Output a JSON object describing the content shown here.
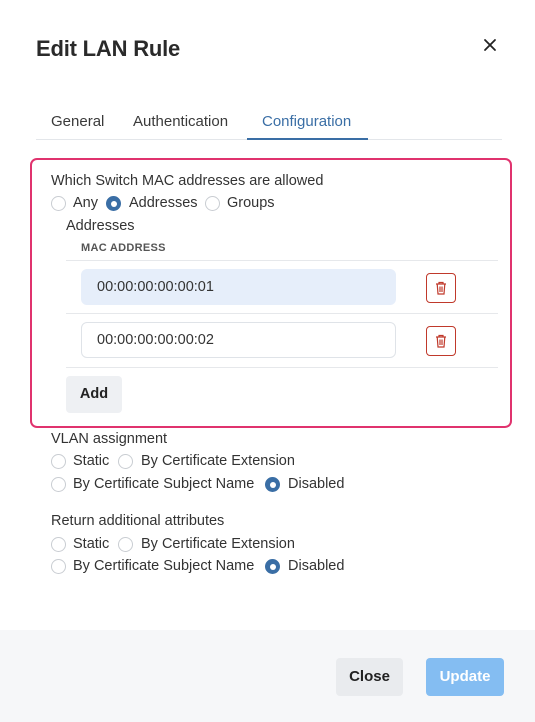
{
  "dialog": {
    "title": "Edit LAN Rule"
  },
  "tabs": [
    {
      "label": "General",
      "active": false
    },
    {
      "label": "Authentication",
      "active": false
    },
    {
      "label": "Configuration",
      "active": true
    }
  ],
  "switch_mac": {
    "question": "Which Switch MAC addresses are allowed",
    "options": [
      "Any",
      "Addresses",
      "Groups"
    ],
    "selected": "Addresses",
    "addresses_label": "Addresses",
    "column_header": "MAC ADDRESS",
    "entries": [
      "00:00:00:00:00:01",
      "00:00:00:00:00:02"
    ],
    "add_label": "Add"
  },
  "vlan": {
    "label": "VLAN assignment",
    "options": [
      "Static",
      "By Certificate Extension",
      "By Certificate Subject Name",
      "Disabled"
    ],
    "selected": "Disabled"
  },
  "return_attrs": {
    "label": "Return additional attributes",
    "options": [
      "Static",
      "By Certificate Extension",
      "By Certificate Subject Name",
      "Disabled"
    ],
    "selected": "Disabled"
  },
  "footer": {
    "close_label": "Close",
    "update_label": "Update"
  },
  "colors": {
    "accent": "#3a6ea5",
    "highlight_border": "#e0336e",
    "delete_red": "#c0392b",
    "update_button": "#84bdf2"
  },
  "icons": [
    "close-icon",
    "trash-icon"
  ]
}
